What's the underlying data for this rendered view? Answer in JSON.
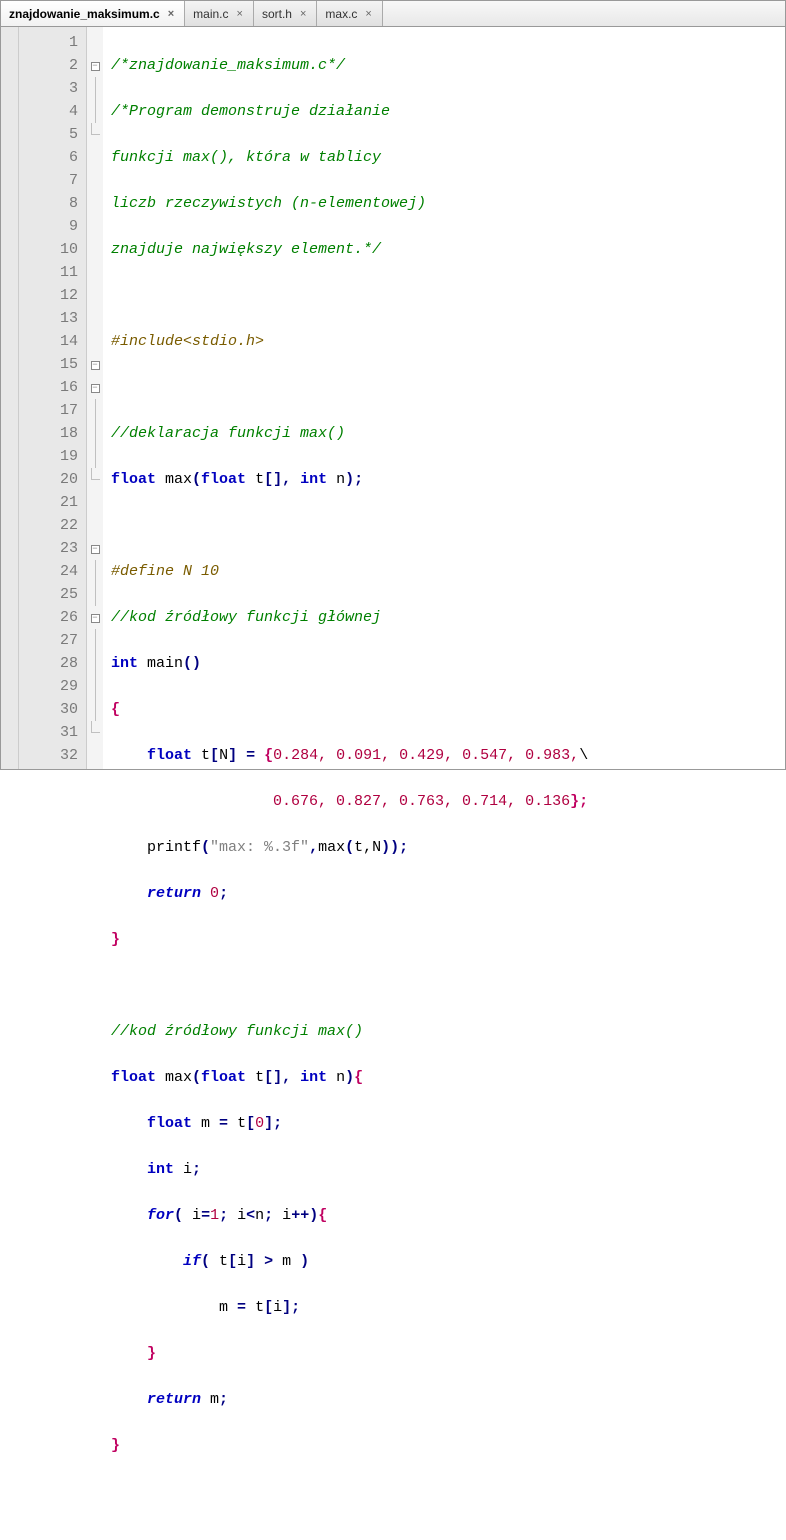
{
  "tabs": [
    {
      "label": "znajdowanie_maksimum.c",
      "active": true
    },
    {
      "label": "main.c",
      "active": false
    },
    {
      "label": "sort.h",
      "active": false
    },
    {
      "label": "max.c",
      "active": false
    }
  ],
  "close_glyph": "×",
  "fold_minus": "−",
  "line_count": 32,
  "code": {
    "l1": "/*znajdowanie_maksimum.c*/",
    "l2": "/*Program demonstruje działanie",
    "l3": "funkcji max(), która w tablicy",
    "l4": "liczb rzeczywistych (n-elementowej)",
    "l5": "znajduje największy element.*/",
    "l7": "#include<stdio.h>",
    "l9": "//deklaracja funkcji max()",
    "l10_kw1": "float",
    "l10_id1": " max",
    "l10_p1": "(",
    "l10_kw2": "float",
    "l10_id2": " t",
    "l10_p2": "[],",
    "l10_sp": " ",
    "l10_kw3": "int",
    "l10_id3": " n",
    "l10_p3": ");",
    "l12": "#define N 10",
    "l13": "//kod źródłowy funkcji głównej",
    "l14_kw": "int",
    "l14_id": " main",
    "l14_p": "()",
    "l15": "{",
    "l16_pre": "    ",
    "l16_kw": "float",
    "l16_id": " t",
    "l16_b1": "[",
    "l16_N": "N",
    "l16_b2": "]",
    "l16_eq": " = ",
    "l16_ob": "{",
    "l16_vals": "0.284, 0.091, 0.429, 0.547, 0.983,",
    "l16_bs": "\\",
    "l17_pre": "                  ",
    "l17_vals": "0.676, 0.827, 0.763, 0.714, 0.136",
    "l17_cb": "};",
    "l18_pre": "    ",
    "l18_fn": "printf",
    "l18_p1": "(",
    "l18_str": "\"max: %.3f\"",
    "l18_c": ",",
    "l18_call": "max",
    "l18_p2": "(",
    "l18_args": "t,N",
    "l18_p3": "));",
    "l19_pre": "    ",
    "l19_kw": "return",
    "l19_sp": " ",
    "l19_v": "0",
    "l19_sc": ";",
    "l20": "}",
    "l22": "//kod źródłowy funkcji max()",
    "l23_kw1": "float",
    "l23_id1": " max",
    "l23_p1": "(",
    "l23_kw2": "float",
    "l23_id2": " t",
    "l23_p2": "[],",
    "l23_sp": " ",
    "l23_kw3": "int",
    "l23_id3": " n",
    "l23_p3": ")",
    "l23_ob": "{",
    "l24_pre": "    ",
    "l24_kw": "float",
    "l24_id": " m ",
    "l24_eq": "=",
    "l24_rhs": " t",
    "l24_b1": "[",
    "l24_idx": "0",
    "l24_b2": "];",
    "l25_pre": "    ",
    "l25_kw": "int",
    "l25_id": " i",
    "l25_sc": ";",
    "l26_pre": "    ",
    "l26_kw": "for",
    "l26_p1": "( ",
    "l26_a": "i",
    "l26_eq": "=",
    "l26_v1": "1",
    "l26_sc1": "; ",
    "l26_b": "i",
    "l26_lt": "<",
    "l26_n": "n",
    "l26_sc2": "; ",
    "l26_c": "i",
    "l26_pp": "++)",
    "l26_ob": "{",
    "l27_pre": "        ",
    "l27_kw": "if",
    "l27_p1": "( ",
    "l27_lhs": "t",
    "l27_b1": "[",
    "l27_i": "i",
    "l27_b2": "]",
    "l27_gt": " > ",
    "l27_m": "m ",
    "l27_p2": ")",
    "l28_pre": "            ",
    "l28_m": "m ",
    "l28_eq": "=",
    "l28_rhs": " t",
    "l28_b1": "[",
    "l28_i": "i",
    "l28_b2": "];",
    "l29_pre": "    ",
    "l29": "}",
    "l30_pre": "    ",
    "l30_kw": "return",
    "l30_id": " m",
    "l30_sc": ";",
    "l31": "}"
  }
}
